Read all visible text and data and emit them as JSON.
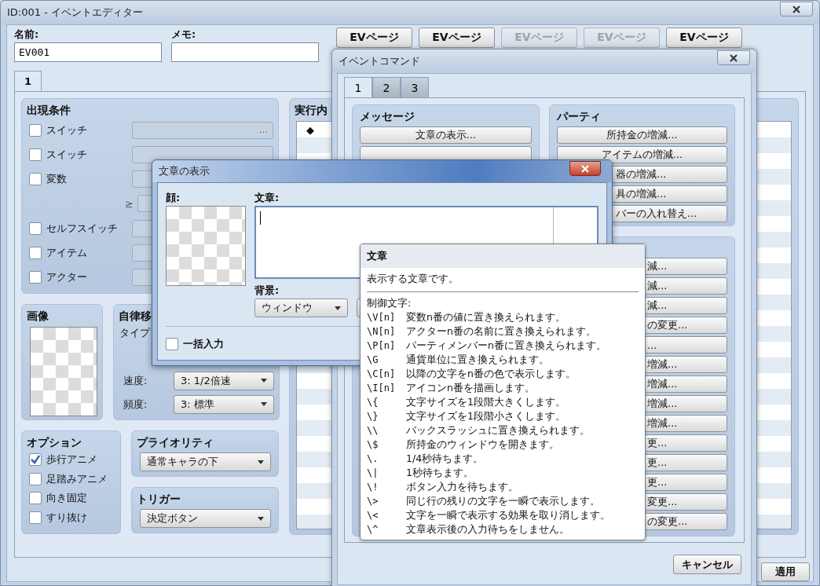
{
  "editor": {
    "title": "ID:001 - イベントエディター",
    "name_label": "名前:",
    "name_value": "EV001",
    "memo_label": "メモ:",
    "page_buttons": [
      {
        "label": "EVページ",
        "disabled": false
      },
      {
        "label": "EVページ",
        "disabled": false
      },
      {
        "label": "EVページ",
        "disabled": true
      },
      {
        "label": "EVページ",
        "disabled": true
      },
      {
        "label": "EVページ",
        "disabled": false
      }
    ],
    "tabs": [
      {
        "label": "1",
        "selected": true
      }
    ],
    "conditions": {
      "title": "出現条件",
      "rows": [
        {
          "kind": "check",
          "label": "スイッチ",
          "checked": false,
          "button": "…"
        },
        {
          "kind": "check",
          "label": "スイッチ",
          "checked": false
        },
        {
          "kind": "check",
          "label": "変数",
          "checked": false
        },
        {
          "kind": "compare",
          "label": "≥"
        },
        {
          "kind": "check",
          "label": "セルフスイッチ",
          "checked": false
        },
        {
          "kind": "check",
          "label": "アイテム",
          "checked": false
        },
        {
          "kind": "check",
          "label": "アクター",
          "checked": false
        }
      ]
    },
    "image": {
      "title": "画像"
    },
    "movement": {
      "title": "自律移",
      "type_label": "タイプ",
      "speed_label": "速度:",
      "speed": "3: 1/2倍速",
      "freq_label": "頻度:",
      "freq": "3: 標準"
    },
    "options": {
      "title": "オプション",
      "items": [
        {
          "label": "歩行アニメ",
          "checked": true
        },
        {
          "label": "足踏みアニメ",
          "checked": false
        },
        {
          "label": "向き固定",
          "checked": false
        },
        {
          "label": "すり抜け",
          "checked": false
        }
      ]
    },
    "priority": {
      "title": "プライオリティ",
      "value": "通常キャラの下"
    },
    "trigger": {
      "title": "トリガー",
      "value": "決定ボタン"
    },
    "contents": {
      "title": "実行内",
      "marker": "◆"
    },
    "apply_button": "適用"
  },
  "command_window": {
    "title": "イベントコマンド",
    "tabs": [
      {
        "label": "1",
        "selected": true
      },
      {
        "label": "2",
        "selected": false
      },
      {
        "label": "3",
        "selected": false
      }
    ],
    "groups": [
      {
        "title": "メッセージ",
        "buttons": [
          {
            "kind": "full",
            "label": "文章の表示..."
          },
          {
            "kind": "blank"
          }
        ]
      },
      {
        "title": "パーティ",
        "buttons": [
          {
            "kind": "full",
            "label": "所持金の増減..."
          },
          {
            "kind": "full",
            "label": "アイテムの増減..."
          },
          {
            "kind": "cut",
            "label": "器の増減..."
          },
          {
            "kind": "cut",
            "label": "具の増減..."
          },
          {
            "kind": "cut",
            "label": "バーの入れ替え..."
          }
        ]
      },
      {
        "buttons": [
          {
            "kind": "cut",
            "label": "減..."
          },
          {
            "kind": "cut",
            "label": "減..."
          },
          {
            "kind": "cut",
            "label": "減..."
          },
          {
            "kind": "cut",
            "label": "の変更..."
          },
          {
            "kind": "cut",
            "label": "..."
          },
          {
            "kind": "cut",
            "label": "増減..."
          },
          {
            "kind": "cut",
            "label": "増減..."
          },
          {
            "kind": "cut",
            "label": "増減..."
          },
          {
            "kind": "cut",
            "label": "増減..."
          },
          {
            "kind": "cut",
            "label": "更..."
          },
          {
            "kind": "cut",
            "label": "更..."
          },
          {
            "kind": "cut",
            "label": "更..."
          },
          {
            "kind": "cut",
            "label": "変更..."
          },
          {
            "kind": "cut",
            "label": "の変更..."
          }
        ]
      }
    ],
    "cancel_button": "キャンセル"
  },
  "dialog": {
    "title": "文章の表示",
    "face_label": "顔:",
    "text_label": "文章:",
    "background_label": "背景:",
    "background_value": "ウィンドウ",
    "batch_label": "一括入力",
    "batch_checked": false
  },
  "tooltip": {
    "title": "文章",
    "description": "表示する文章です。",
    "section": "制御文字:",
    "codes": [
      {
        "code": "\\V[n]",
        "text": "変数n番の値に置き換えられます。"
      },
      {
        "code": "\\N[n]",
        "text": "アクターn番の名前に置き換えられます。"
      },
      {
        "code": "\\P[n]",
        "text": "パーティメンバーn番に置き換えられます。"
      },
      {
        "code": "\\G",
        "text": "通貨単位に置き換えられます。"
      },
      {
        "code": "\\C[n]",
        "text": "以降の文字をn番の色で表示します。"
      },
      {
        "code": "\\I[n]",
        "text": "アイコンn番を描画します。"
      },
      {
        "code": "\\{",
        "text": "文字サイズを1段階大きくします。"
      },
      {
        "code": "\\}",
        "text": "文字サイズを1段階小さくします。"
      },
      {
        "code": "\\\\",
        "text": "バックスラッシュに置き換えられます。"
      },
      {
        "code": "\\$",
        "text": "所持金のウィンドウを開きます。"
      },
      {
        "code": "\\.",
        "text": "1/4秒待ちます。"
      },
      {
        "code": "\\|",
        "text": "1秒待ちます。"
      },
      {
        "code": "\\!",
        "text": "ボタン入力を待ちます。"
      },
      {
        "code": "\\>",
        "text": "同じ行の残りの文字を一瞬で表示します。"
      },
      {
        "code": "\\<",
        "text": "文字を一瞬で表示する効果を取り消します。"
      },
      {
        "code": "\\^",
        "text": "文章表示後の入力待ちをしません。"
      }
    ]
  }
}
